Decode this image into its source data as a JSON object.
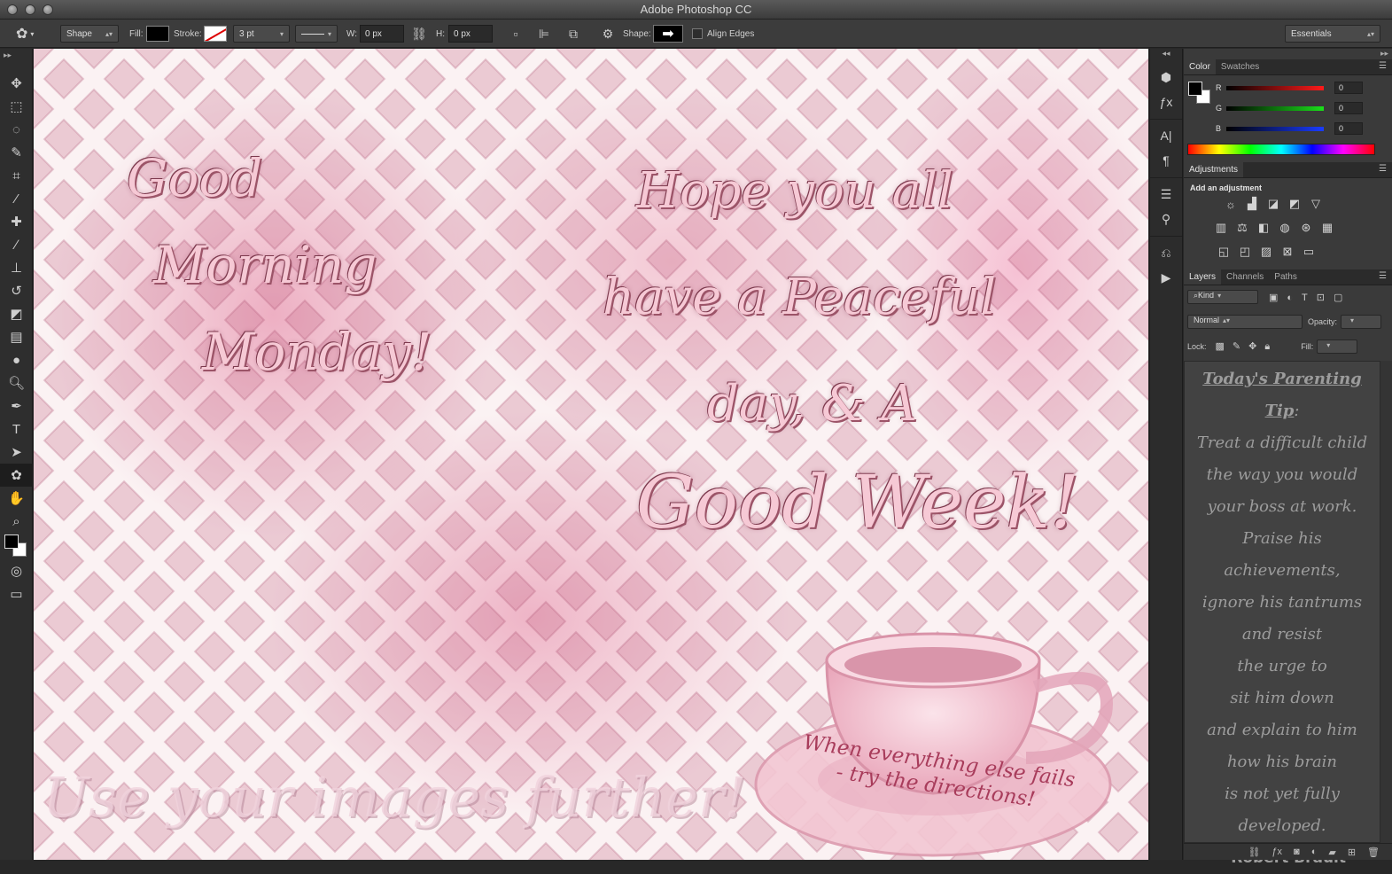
{
  "app": {
    "title": "Adobe Photoshop CC"
  },
  "options_bar": {
    "tool_mode": "Shape",
    "fill_label": "Fill:",
    "stroke_label": "Stroke:",
    "stroke_width": "3 pt",
    "w_label": "W:",
    "w_value": "0 px",
    "h_label": "H:",
    "h_value": "0 px",
    "shape_label": "Shape:",
    "align_edges_label": "Align Edges",
    "workspace": "Essentials"
  },
  "color_panel": {
    "tabs": [
      "Color",
      "Swatches"
    ],
    "active_tab": "Color",
    "channels": [
      {
        "label": "R",
        "value": "0",
        "color": "#e02020"
      },
      {
        "label": "G",
        "value": "0",
        "color": "#20c020"
      },
      {
        "label": "B",
        "value": "0",
        "color": "#2040e0"
      }
    ]
  },
  "adjustments_panel": {
    "tab": "Adjustments",
    "heading": "Add an adjustment"
  },
  "layers_panel": {
    "tabs": [
      "Layers",
      "Channels",
      "Paths"
    ],
    "active_tab": "Layers",
    "filter_kind": "Kind",
    "blend_mode": "Normal",
    "opacity_label": "Opacity:",
    "lock_label": "Lock:",
    "fill_label": "Fill:"
  },
  "tip": {
    "title": "Today's Parenting Tip",
    "title_suffix": ":",
    "lines": [
      "Treat a difficult child",
      "the way you would",
      "your boss at work.",
      "Praise his",
      "achievements,",
      "ignore his tantrums",
      "and resist",
      "the urge to",
      "sit him down",
      "and explain to him",
      "how his brain",
      "is not yet fully",
      "developed."
    ],
    "author": "~Robert Brault"
  },
  "canvas": {
    "left_lines": [
      "Good",
      "Morning",
      "Monday!"
    ],
    "right_lines": [
      "Hope you all",
      "have a Peaceful",
      "day, & A",
      "Good Week!"
    ],
    "watermark": "Use your images further!",
    "saucer_lines": [
      "When everything else fails",
      "- try the directions!"
    ]
  },
  "colors": {
    "accent_pink": "#f6c9d5",
    "dark_pink": "#a83c5b",
    "panel_bg": "#3a3a3a"
  }
}
